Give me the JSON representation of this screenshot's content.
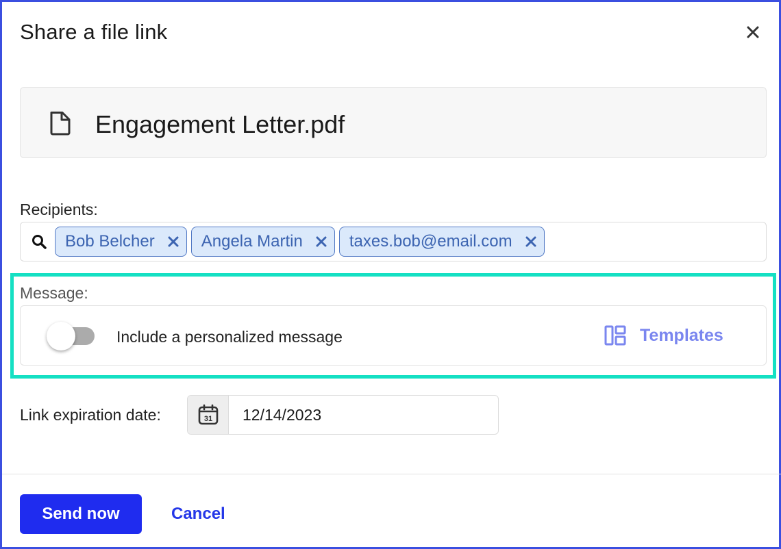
{
  "dialog": {
    "title": "Share a file link"
  },
  "file": {
    "name": "Engagement Letter.pdf",
    "icon": "file-icon"
  },
  "recipients": {
    "label": "Recipients:",
    "search_icon": "search-icon",
    "chips": [
      {
        "label": "Bob Belcher"
      },
      {
        "label": "Angela Martin"
      },
      {
        "label": "taxes.bob@email.com"
      }
    ]
  },
  "message": {
    "label": "Message:",
    "toggle_on": false,
    "toggle_label": "Include a personalized message",
    "templates_label": "Templates",
    "templates_icon": "layout-template-icon"
  },
  "expiration": {
    "label": "Link expiration date:",
    "calendar_day": "31",
    "value": "12/14/2023"
  },
  "footer": {
    "send_label": "Send now",
    "cancel_label": "Cancel"
  },
  "colors": {
    "frame": "#3b4fe0",
    "highlight": "#14e0c3",
    "primary": "#1f2cef",
    "chip_bg": "#dbe9fb",
    "chip_text": "#3c64b1",
    "templates": "#7a86ef"
  }
}
